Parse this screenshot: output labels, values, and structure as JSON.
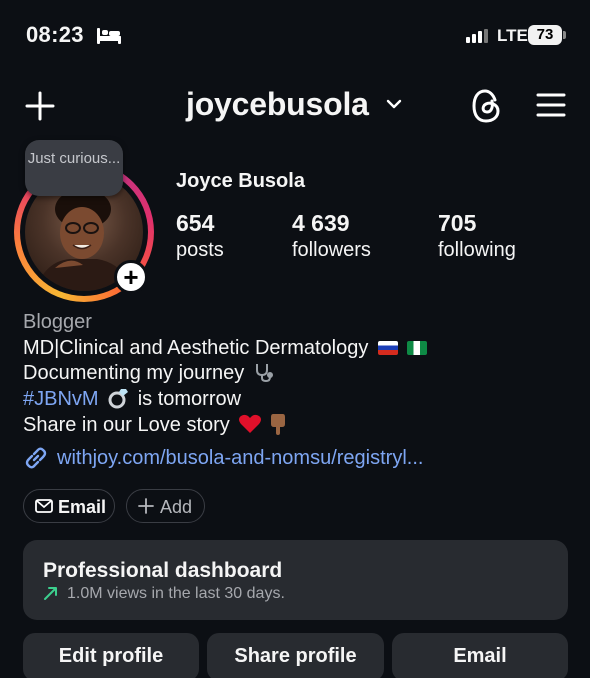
{
  "status_bar": {
    "time": "08:23",
    "network": "LTE",
    "battery": "73"
  },
  "header": {
    "username": "joycebusola"
  },
  "profile": {
    "note": "Just curious...",
    "display_name": "Joyce Busola",
    "stats": [
      {
        "value": "654",
        "label": "posts"
      },
      {
        "value": "4 639",
        "label": "followers"
      },
      {
        "value": "705",
        "label": "following"
      }
    ]
  },
  "bio": {
    "category": "Blogger",
    "line1": "MD|Clinical and Aesthetic Dermatology",
    "line2": "Documenting my journey",
    "hashtag": "#JBNvM",
    "line3_rest": "is tomorrow",
    "line4": "Share in our Love story",
    "link": "withjoy.com/busola-and-nomsu/registryl..."
  },
  "action_pills": {
    "email": "Email",
    "add": "Add"
  },
  "dashboard": {
    "title": "Professional dashboard",
    "subtitle": "1.0M views in the last 30 days."
  },
  "buttons": {
    "edit": "Edit profile",
    "share": "Share profile",
    "email": "Email"
  },
  "icons": [
    "bed-icon",
    "signal-icon",
    "plus-icon",
    "chevron-down-icon",
    "threads-icon",
    "menu-icon",
    "link-icon",
    "mail-icon",
    "trend-up-icon"
  ],
  "colors": {
    "background": "#0c0f14",
    "card": "#282b30",
    "link": "#7ea6f3",
    "trend": "#3ccf8e"
  }
}
